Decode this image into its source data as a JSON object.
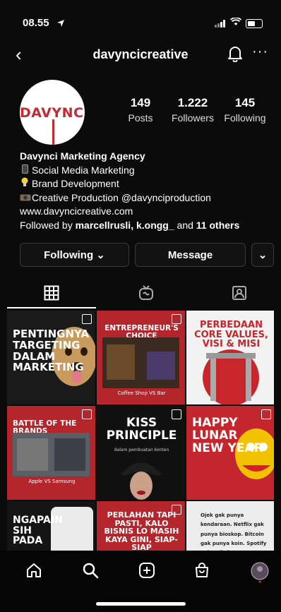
{
  "status": {
    "time": "08.55"
  },
  "header": {
    "back": "‹",
    "username": "davyncicreative",
    "more": "···"
  },
  "profile": {
    "logo_text": "DAVYNCI",
    "stats": [
      {
        "value": "149",
        "label": "Posts"
      },
      {
        "value": "1.222",
        "label": "Followers"
      },
      {
        "value": "145",
        "label": "Following"
      }
    ]
  },
  "bio": {
    "name": "Davynci Marketing Agency",
    "line1": "Social Media Marketing",
    "line2": "Brand Development",
    "line3": "Creative Production @davynciproduction",
    "website": "www.davyncicreative.com",
    "followed_prefix": "Followed by ",
    "followed_names": "marcellrusli, k.ongg_",
    "followed_mid": " and ",
    "followed_others": "11 others"
  },
  "buttons": {
    "following": "Following ⌄",
    "message": "Message",
    "more": "⌄"
  },
  "posts": [
    {
      "text": "PENTINGNYA TARGETING DALAM MARKETING",
      "bg": "#1a1a1a",
      "accent": "#c5a070"
    },
    {
      "text": "ENTREPRENEUR'S CHOICE",
      "sub": "Coffee Shop  VS  Bar",
      "bg": "#b4252c"
    },
    {
      "text": "PERBEDAAN CORE VALUES, VISI & MISI",
      "bg": "#f2f2f2",
      "accent": "#c8262d"
    },
    {
      "text": "BATTLE OF THE BRANDS",
      "sub": "Apple  VS  Samsung",
      "bg": "#b4252c"
    },
    {
      "text": "KISS PRINCIPLE",
      "sub": "dalam pembuatan konten",
      "bg": "#111"
    },
    {
      "text": "HAPPY LUNAR NEW YEAR",
      "bg": "#c3262c",
      "accent": "#f2c200"
    },
    {
      "text": "NGAPAIN SIH PADA",
      "bg": "#151515"
    },
    {
      "text": "PERLAHAN TAPI PASTI, KALO BISNIS LO MASIH KAYA GINI, SIAP-SIAP",
      "bg": "#b4252c"
    },
    {
      "text": "Ojek gak punya kendaraan. Netflix gak punya bioskop. Bitcoin gak punya koin. Spotify gak nulis lagu",
      "bg": "#ececec"
    }
  ],
  "colors": {
    "brand_red": "#c32a31",
    "background": "#0b0b0b"
  }
}
